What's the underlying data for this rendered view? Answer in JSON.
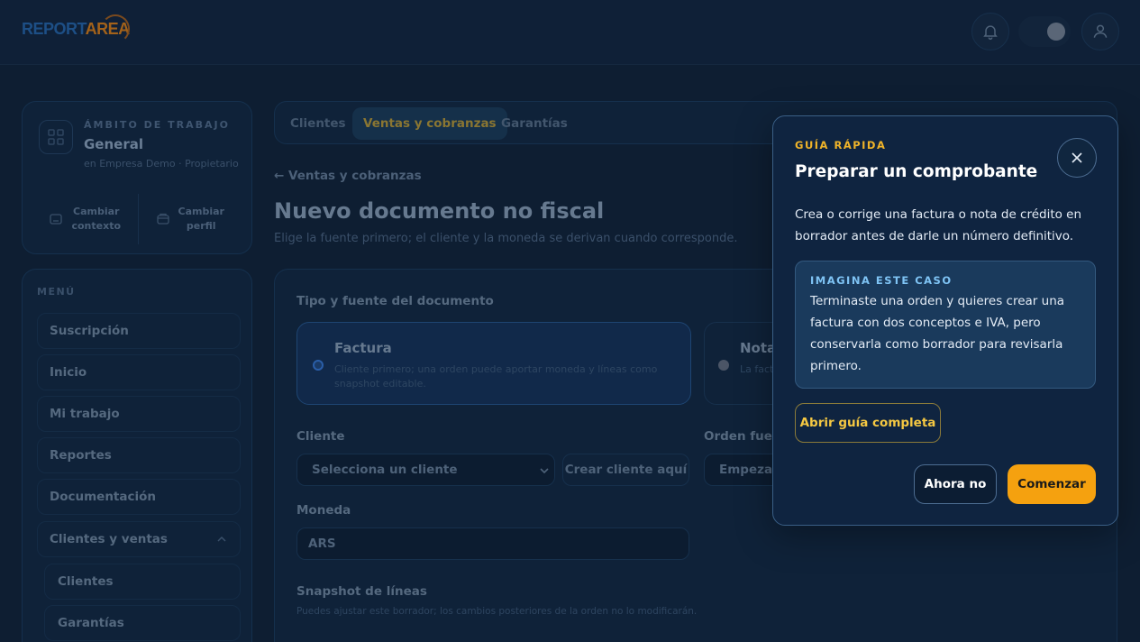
{
  "brand": {
    "logo_part1": "REPORT",
    "logo_part2": "AREA"
  },
  "header": {
    "icons": [
      "bell-icon",
      "theme-toggle",
      "user-icon"
    ]
  },
  "workspace": {
    "label": "ÁMBITO DE TRABAJO",
    "title": "General",
    "subtitle": "en Empresa Demo · Propietario",
    "actions": [
      {
        "label_line1": "Cambiar",
        "label_line2": "contexto",
        "icon": "context-icon"
      },
      {
        "label_line1": "Cambiar",
        "label_line2": "perfil",
        "icon": "profile-icon"
      }
    ]
  },
  "menu": {
    "label": "MENÚ",
    "items": [
      "Suscripción",
      "Inicio",
      "Mi trabajo",
      "Reportes",
      "Documentación",
      "Clientes y ventas"
    ],
    "sub_items": [
      "Clientes",
      "Garantías"
    ]
  },
  "tabs": [
    "Clientes",
    "Ventas y cobranzas",
    "Garantías"
  ],
  "page": {
    "back": "← Ventas y cobranzas",
    "title": "Nuevo documento no fiscal",
    "subtitle": "Elige la fuente primero; el cliente y la moneda se derivan cuando corresponde."
  },
  "form": {
    "doc_type_label": "Tipo y fuente del documento",
    "options": [
      {
        "title": "Factura",
        "desc": "Cliente primero; una orden puede aportar moneda y líneas como snapshot editable."
      },
      {
        "title": "Nota",
        "desc": "La fact"
      }
    ],
    "client_label": "Cliente",
    "client_select": "Selecciona un cliente",
    "create_client": "Crear cliente aquí",
    "order_label": "Orden fuent",
    "order_input": "Empezar",
    "currency_label": "Moneda",
    "currency_value": "ARS",
    "lines_label": "Snapshot de líneas",
    "lines_hint": "Puedes ajustar este borrador; los cambios posteriores de la orden no lo modificarán."
  },
  "guide": {
    "eyebrow": "GUÍA RÁPIDA",
    "title": "Preparar un comprobante",
    "description": "Crea o corrige una factura o nota de crédito en borrador antes de darle un número definitivo.",
    "case_label": "IMAGINA ESTE CASO",
    "case_text": "Terminaste una orden y quieres crear una factura con dos conceptos e IVA, pero conservarla como borrador para revisarla primero.",
    "open_guide": "Abrir guía completa",
    "dismiss": "Ahora no",
    "start": "Comenzar"
  }
}
